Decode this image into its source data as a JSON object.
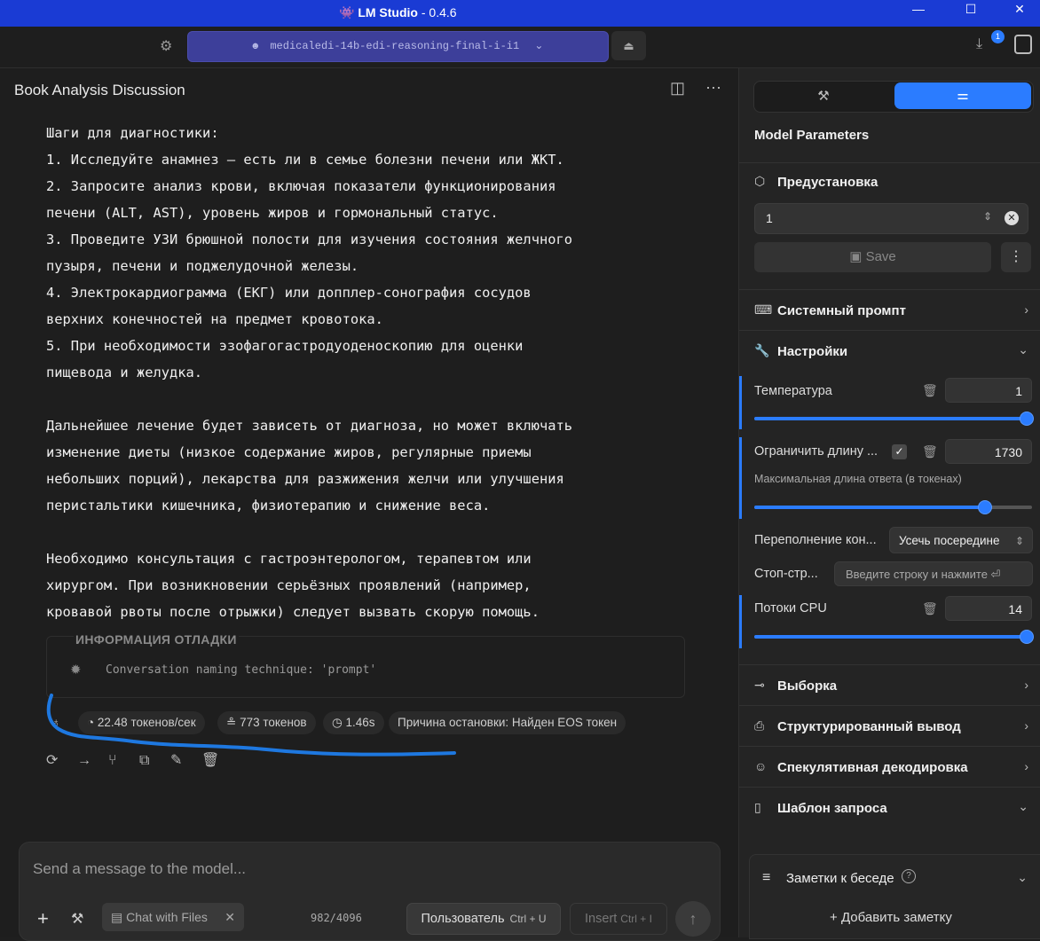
{
  "window": {
    "app_name": "LM Studio",
    "version": "- 0.4.6",
    "minimize": "—",
    "maximize": "☐",
    "close": "✕"
  },
  "toolbar": {
    "model_name": "medicaledi-14b-edi-reasoning-final-i-i1",
    "downloads_badge": "1"
  },
  "chat": {
    "title": "Book Analysis Discussion",
    "paragraphs": [
      "Шаги для диагностики:\n1. Исследуйте анамнез — есть ли в семье болезни печени или ЖКТ.\n2. Запросите анализ крови, включая показатели функционирования\nпечени (ALT, AST), уровень жиров и гормональный статус.\n3. Проведите УЗИ брюшной полости для изучения состояния желчного\nпузыря, печени и поджелудочной железы.\n4. Электрокардиограмма (ЕКГ) или допплер-сонография сосудов\nверхних конечностей на предмет кровотока.\n5. При необходимости эзофагогастродуоденоскопию для оценки\nпищевода и желудка.",
      "Дальнейшее лечение будет зависеть от диагноза, но может включать\nизменение диеты (низкое содержание жиров, регулярные приемы\nнебольших порций), лекарства для разжижения желчи или улучшения\nперистальтики кишечника, физиотерапию и снижение веса.",
      "Необходимо консультация с гастроэнтерологом, терапевтом или\nхирургом. При возникновении серьёзных проявлений (например,\nкровавой рвоты после отрыжки) следует вызвать скорую помощь."
    ],
    "debug": {
      "heading": "ИНФОРМАЦИЯ ОТЛАДКИ",
      "text": "Conversation naming technique: 'prompt'"
    },
    "stats": {
      "speed": "22.48 токенов/сек",
      "tokens": "773 токенов",
      "time": "1.46s",
      "stop_reason": "Причина остановки: Найден EOS токен"
    }
  },
  "composer": {
    "placeholder": "Send a message to the model...",
    "chat_with_files": "Chat with Files",
    "token_count": "982/4096",
    "role_label": "Пользователь",
    "role_shortcut": "Ctrl + U",
    "insert_label": "Insert",
    "insert_shortcut": "Ctrl + I"
  },
  "sidebar": {
    "heading": "Model Parameters",
    "preset_label": "Предустановка",
    "preset_value": "1",
    "save_label": "Save",
    "sections": {
      "system_prompt": "Системный промпт",
      "settings": "Настройки",
      "sampling": "Выборка",
      "structured": "Структурированный вывод",
      "speculative": "Спекулятивная декодировка",
      "template": "Шаблон запроса"
    },
    "temperature": {
      "label": "Температура",
      "value": "1",
      "fraction": 0.98
    },
    "limit": {
      "label": "Ограничить длину ...",
      "value": "1730",
      "sublabel": "Максимальная длина ответа (в токенах)",
      "fraction": 0.83
    },
    "overflow": {
      "label": "Переполнение кон...",
      "value": "Усечь посередине"
    },
    "stop": {
      "label": "Стоп-стр...",
      "placeholder": "Введите строку и нажмите ⏎"
    },
    "cpu": {
      "label": "Потоки CPU",
      "value": "14",
      "fraction": 0.98
    },
    "notes": {
      "label": "Заметки к беседе",
      "add_label": "Добавить заметку"
    }
  },
  "colors": {
    "accent": "#2b7cff",
    "titlebar": "#1a3bd4",
    "model_pill": "#3d3f9a",
    "annotation": "#1e78e0"
  }
}
